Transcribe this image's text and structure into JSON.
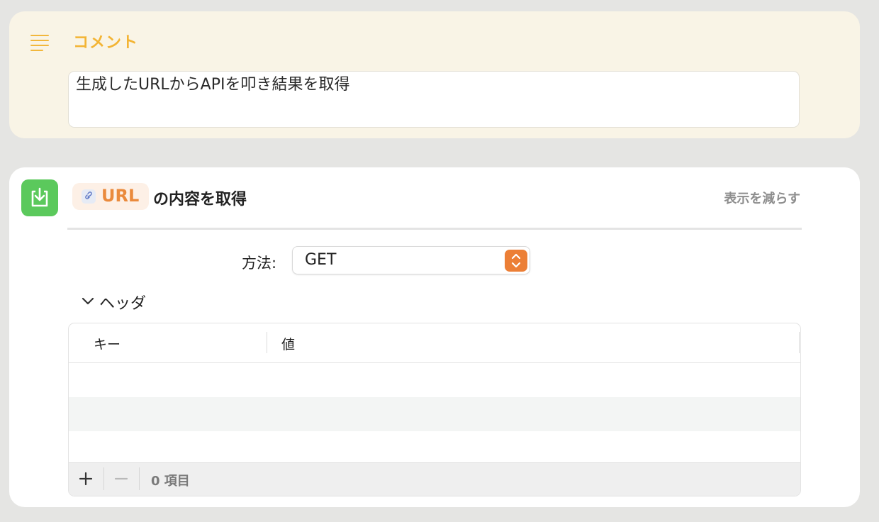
{
  "comment": {
    "title": "コメント",
    "text": "生成したURLからAPIを叩き結果を取得"
  },
  "action": {
    "token_label": "URL",
    "title": "の内容を取得",
    "show_less": "表示を減らす",
    "method_label": "方法:",
    "method_value": "GET",
    "headers_label": "ヘッダ",
    "table": {
      "columns": [
        "キー",
        "値"
      ],
      "item_count": "0 項目"
    }
  },
  "colors": {
    "comment_accent": "#f3b434",
    "action_icon": "#5bc95c",
    "url_token": "#ea8a3c",
    "stepper": "#ec7f36"
  },
  "icons": {
    "comment": "text-lines-icon",
    "action": "download-icon",
    "token": "link-icon"
  }
}
